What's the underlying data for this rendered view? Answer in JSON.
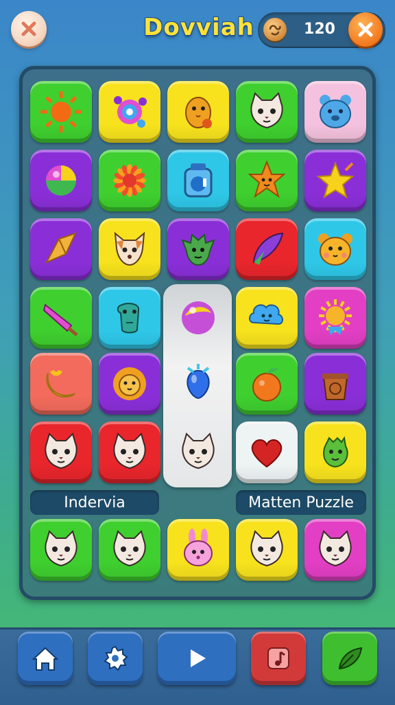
{
  "header": {
    "title": "Dovviah",
    "score": "120"
  },
  "labels": {
    "left": "Indervia",
    "right": "Matten Puzzle"
  },
  "colors": {
    "yellow": "#f7e21d",
    "green": "#3fcf2f",
    "purple": "#8a2fd8",
    "red": "#e8262c",
    "pink": "#f0b9d9",
    "cyan": "#2fc7e8",
    "coral": "#f26b5c",
    "magenta": "#e23fc4",
    "white": "#eef3f4"
  },
  "grid": [
    [
      {
        "bg": "green",
        "icon": "sun-icon"
      },
      {
        "bg": "yellow",
        "icon": "candy-swirl-icon"
      },
      {
        "bg": "yellow",
        "icon": "bird-icon"
      },
      {
        "bg": "green",
        "icon": "cat-icon"
      },
      {
        "bg": "pink",
        "icon": "bear-icon"
      }
    ],
    [
      {
        "bg": "purple",
        "icon": "ball-icon"
      },
      {
        "bg": "green",
        "icon": "flower-icon"
      },
      {
        "bg": "cyan",
        "icon": "jar-icon"
      },
      {
        "bg": "green",
        "icon": "star-face-icon"
      },
      {
        "bg": "purple",
        "icon": "star-icon"
      }
    ],
    [
      {
        "bg": "purple",
        "icon": "crystal-icon"
      },
      {
        "bg": "yellow",
        "icon": "fox-icon"
      },
      {
        "bg": "purple",
        "icon": "goblin-icon"
      },
      {
        "bg": "red",
        "icon": "feather-icon"
      },
      {
        "bg": "cyan",
        "icon": "hamster-icon"
      }
    ],
    [
      {
        "bg": "green",
        "icon": "popsicle-icon"
      },
      {
        "bg": "cyan",
        "icon": "dino-icon"
      },
      {
        "bg": "selected",
        "icon": "orb-icon"
      },
      {
        "bg": "yellow",
        "icon": "cloud-face-icon"
      },
      {
        "bg": "magenta",
        "icon": "sun-face-icon"
      }
    ],
    [
      {
        "bg": "coral",
        "icon": "banana-icon"
      },
      {
        "bg": "purple",
        "icon": "lion-icon"
      },
      {
        "bg": "selected",
        "icon": "balloon-icon"
      },
      {
        "bg": "green",
        "icon": "orange-icon"
      },
      {
        "bg": "purple",
        "icon": "basket-icon"
      }
    ],
    [
      {
        "bg": "red",
        "icon": "cat-icon"
      },
      {
        "bg": "red",
        "icon": "cat-icon"
      },
      {
        "bg": "selected",
        "icon": "cat-icon"
      },
      {
        "bg": "white",
        "icon": "heart-icon"
      },
      {
        "bg": "yellow",
        "icon": "dragon-icon"
      }
    ],
    [
      {
        "bg": "green",
        "icon": "cat-icon"
      },
      {
        "bg": "green",
        "icon": "cat-icon"
      },
      {
        "bg": "yellow",
        "icon": "rabbit-icon"
      },
      {
        "bg": "yellow",
        "icon": "cat-icon"
      },
      {
        "bg": "magenta",
        "icon": "cat-icon"
      }
    ]
  ],
  "nav": [
    {
      "icon": "home-icon",
      "bg": "#2f6fc0"
    },
    {
      "icon": "gear-icon",
      "bg": "#2f6fc0"
    },
    {
      "icon": "play-icon",
      "bg": "#2f6fc0"
    },
    {
      "icon": "music-icon",
      "bg": "#d23a3a"
    },
    {
      "icon": "leaf-icon",
      "bg": "#3fbf2f"
    }
  ]
}
